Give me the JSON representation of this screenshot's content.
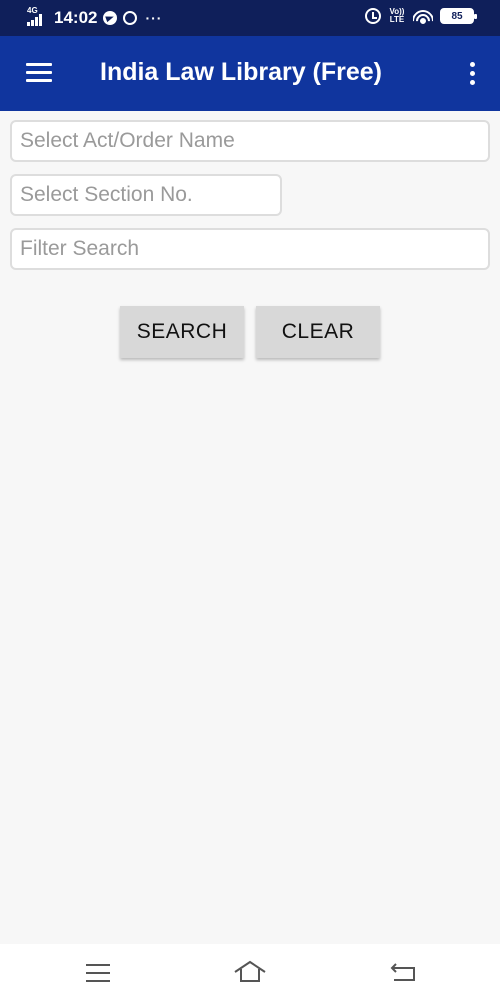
{
  "status_bar": {
    "network_label": "4G",
    "time": "14:02",
    "more_dots": "···",
    "volte_label": "Vo)) LTE",
    "battery_level": "85",
    "icons": [
      "signal-icon",
      "telegram-icon",
      "whatsapp-icon",
      "alarm-icon",
      "wifi-icon",
      "battery-icon"
    ]
  },
  "app_bar": {
    "title": "India Law Library (Free)",
    "color": "#10359e"
  },
  "form": {
    "act_placeholder": "Select Act/Order Name",
    "act_value": "",
    "section_placeholder": "Select Section No.",
    "section_value": "",
    "filter_placeholder": "Filter Search",
    "filter_value": ""
  },
  "buttons": {
    "search_label": "SEARCH",
    "clear_label": "CLEAR"
  },
  "nav_bar": {
    "icons": [
      "nav-menu-icon",
      "nav-home-icon",
      "nav-back-icon"
    ]
  }
}
